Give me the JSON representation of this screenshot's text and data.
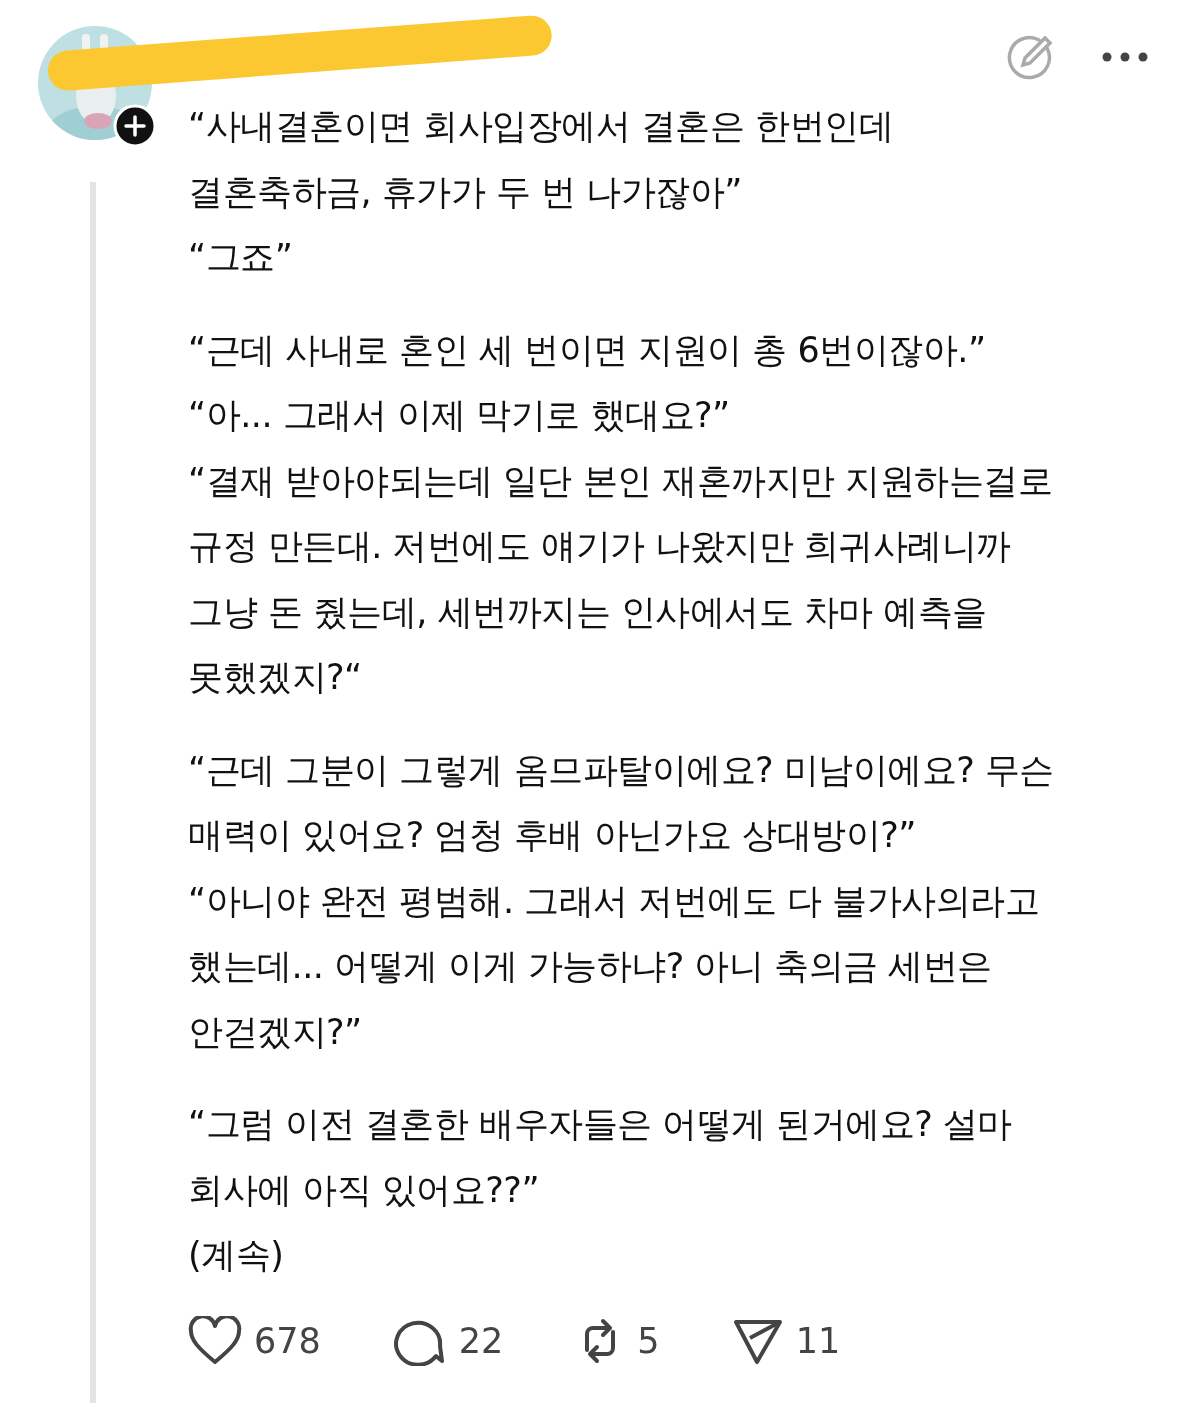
{
  "post": {
    "paragraphs": [
      {
        "lines": [
          "“사내결혼이면 회사입장에서 결혼은 한번인데",
          "결혼축하금, 휴가가 두 번 나가잖아”",
          "“그죠”"
        ]
      },
      {
        "lines": [
          "“근데 사내로 혼인 세 번이면 지원이 총 6번이잖아.”",
          "“아... 그래서 이제 막기로 했대요?”",
          "“결재 받아야되는데 일단 본인 재혼까지만 지원하는걸로",
          "규정 만든대. 저번에도 얘기가 나왔지만 희귀사례니까",
          "그냥 돈 줬는데, 세번까지는 인사에서도 차마 예측을",
          "못했겠지?“"
        ]
      },
      {
        "lines": [
          "“근데 그분이 그렇게 옴므파탈이에요? 미남이에요? 무슨",
          "매력이 있어요? 엄청 후배 아닌가요 상대방이?”",
          "“아니야 완전 평범해. 그래서 저번에도 다 불가사의라고",
          "했는데... 어떻게 이게 가능하냐? 아니 축의금 세번은",
          "안걷겠지?”"
        ]
      },
      {
        "lines": [
          "“그럼 이전 결혼한 배우자들은 어떻게 된거에요? 설마",
          "회사에 아직 있어요??”",
          "(계속)"
        ]
      }
    ]
  },
  "actions": [
    {
      "kind": "like",
      "count": "678"
    },
    {
      "kind": "comment",
      "count": "22"
    },
    {
      "kind": "repost",
      "count": "5"
    },
    {
      "kind": "share",
      "count": "11"
    }
  ]
}
